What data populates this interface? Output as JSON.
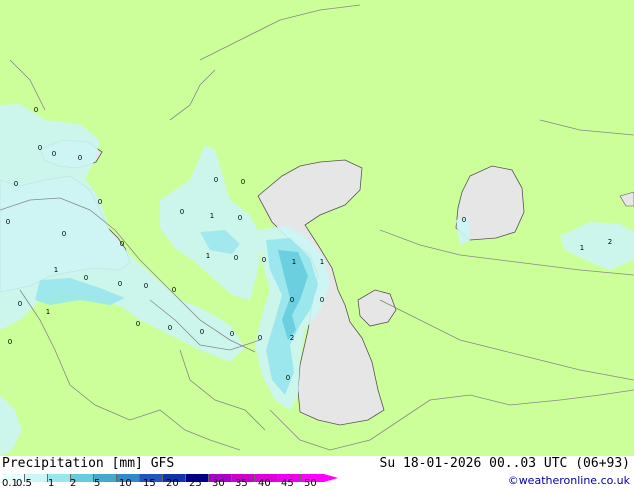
{
  "colors": {
    "land": "#ccff99",
    "sea": "#e6e6e6",
    "precip_light": "#ccf5f5",
    "precip_mid": "#99e6ee",
    "precip_heavy": "#66ccdd",
    "border": "#888888",
    "coast": "#555555"
  },
  "footer": {
    "title_left": "Precipitation [mm] GFS",
    "title_right": "Su 18-01-2026 00..03 UTC (06+93)",
    "credit": "©weatheronline.co.uk"
  },
  "legend": {
    "labels": [
      "0.1",
      "0.5",
      "1",
      "2",
      "5",
      "10",
      "15",
      "20",
      "25",
      "30",
      "35",
      "40",
      "45",
      "50"
    ],
    "colors": [
      "#e6ffff",
      "#ccf5f5",
      "#99e6ee",
      "#66ccdd",
      "#44aacc",
      "#3388cc",
      "#2255bb",
      "#1133aa",
      "#000088",
      "#aa00cc",
      "#cc00cc",
      "#dd00dd",
      "#ee00ee",
      "#ff00ff"
    ]
  },
  "map_values": [
    "0",
    "0",
    "0",
    "0",
    "0",
    "0",
    "0",
    "0",
    "0",
    "1",
    "0",
    "0",
    "0",
    "0",
    "1",
    "1",
    "0",
    "0",
    "1",
    "0",
    "0",
    "0",
    "0",
    "0",
    "0",
    "0",
    "0",
    "1",
    "0",
    "0",
    "2",
    "0",
    "0",
    "1",
    "2",
    "1",
    "0",
    "0",
    "0"
  ]
}
